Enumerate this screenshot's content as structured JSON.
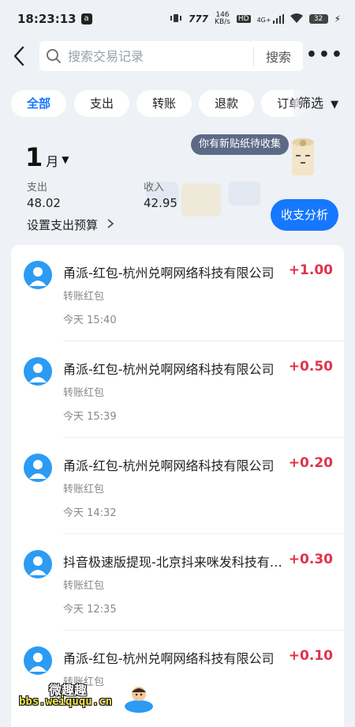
{
  "status_bar": {
    "time": "18:23:13",
    "app_badge": "a",
    "net_speed_top": "146",
    "net_speed_unit": "KB/s",
    "hd": "HD",
    "signal": "4G+",
    "battery": "32"
  },
  "search": {
    "placeholder": "搜索交易记录",
    "button": "搜索"
  },
  "filters": {
    "chips": [
      "全部",
      "支出",
      "转账",
      "退款",
      "订单"
    ],
    "active_index": 0,
    "filter_label": "筛选"
  },
  "summary": {
    "month": "1",
    "month_unit": "月",
    "bubble": "你有新贴纸待收集",
    "expense_label": "支出",
    "expense_value": "48.02",
    "income_label": "收入",
    "income_value": "42.95",
    "budget_link": "设置支出预算",
    "analysis_button": "收支分析"
  },
  "transactions": [
    {
      "title": "甬派-红包-杭州兑啊网络科技有限公司",
      "amount": "+1.00",
      "type": "转账红包",
      "time": "今天 15:40"
    },
    {
      "title": "甬派-红包-杭州兑啊网络科技有限公司",
      "amount": "+0.50",
      "type": "转账红包",
      "time": "今天 15:39"
    },
    {
      "title": "甬派-红包-杭州兑啊网络科技有限公司",
      "amount": "+0.20",
      "type": "转账红包",
      "time": "今天 14:32"
    },
    {
      "title": "抖音极速版提现-北京抖来咪发科技有限公司",
      "amount": "+0.30",
      "type": "转账红包",
      "time": "今天 12:35"
    },
    {
      "title": "甬派-红包-杭州兑啊网络科技有限公司",
      "amount": "+0.10",
      "type": "转账红包",
      "time": ""
    }
  ],
  "watermark": {
    "line1": "微趣趣",
    "line2": "bbs.weiququ.cn"
  },
  "colors": {
    "accent": "#1677ff",
    "income": "#e0334a",
    "background": "#eef1f5"
  }
}
